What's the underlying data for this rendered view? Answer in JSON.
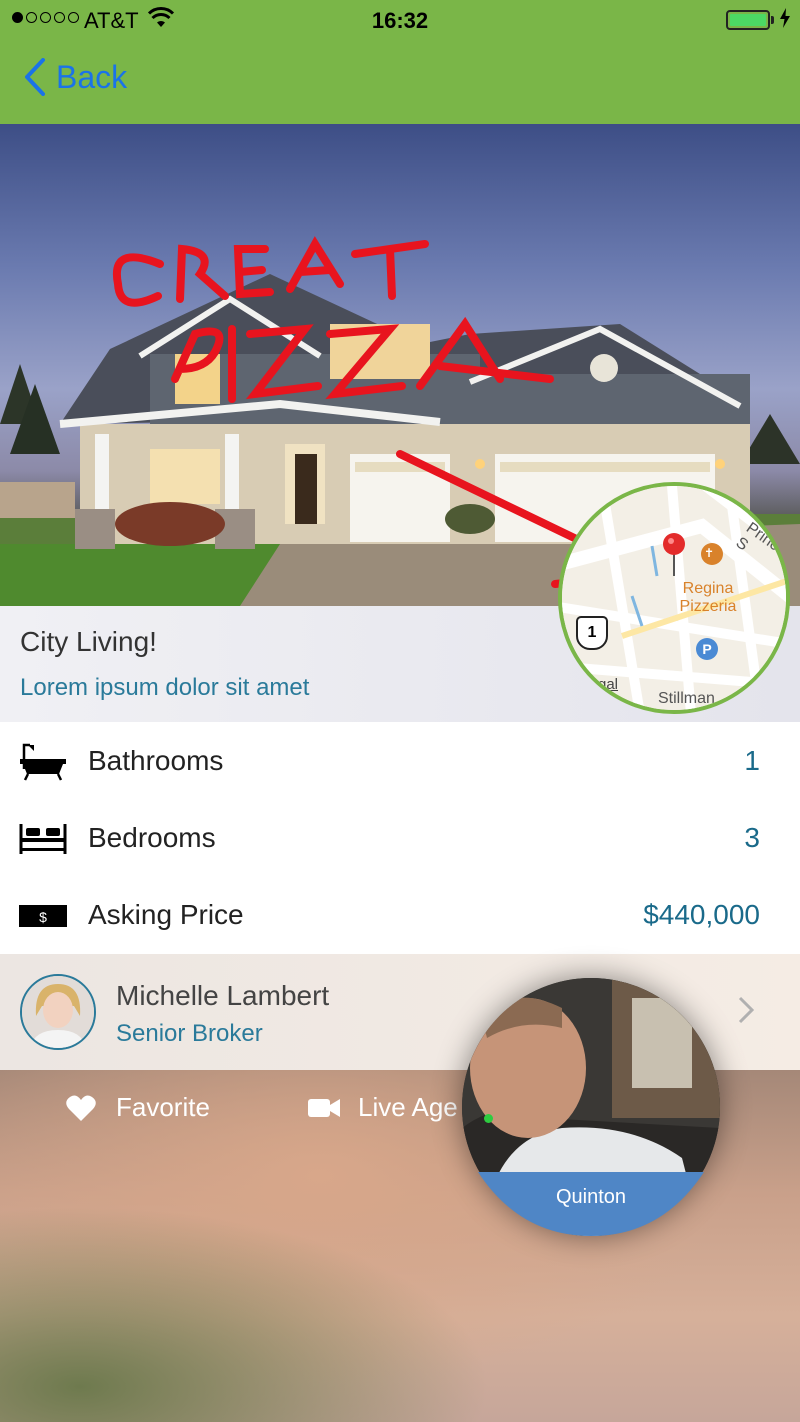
{
  "status_bar": {
    "carrier": "AT&T",
    "time": "16:32",
    "signal_bars_filled": 1,
    "signal_bars_total": 5,
    "battery_level": 1.0,
    "battery_color": "#4cd964"
  },
  "nav": {
    "back_label": "Back",
    "bar_color": "#7ab648",
    "accent": "#1a73e8"
  },
  "hero": {
    "annotation_line1": "GREAT",
    "annotation_line2": "PIZZA",
    "annotation_color": "#e8141e"
  },
  "map": {
    "place_line1": "Regina",
    "place_line2": "Pizzeria",
    "street_top": "Prince S",
    "street_bottom": "Stillman",
    "route_shield": "1",
    "parking": "P",
    "partial_label": "gal"
  },
  "listing": {
    "title": "City Living!",
    "subtitle": "Lorem ipsum dolor sit amet"
  },
  "details": [
    {
      "icon": "bathtub-icon",
      "label": "Bathrooms",
      "value": "1"
    },
    {
      "icon": "bed-icon",
      "label": "Bedrooms",
      "value": "3"
    },
    {
      "icon": "dollar-bill-icon",
      "label": "Asking Price",
      "value": "$440,000"
    }
  ],
  "agent": {
    "name": "Michelle Lambert",
    "role": "Senior Broker"
  },
  "actions": {
    "favorite_label": "Favorite",
    "live_label": "Live Age"
  },
  "video_call": {
    "caller_name": "Quinton",
    "label_color": "#4f86c6"
  }
}
